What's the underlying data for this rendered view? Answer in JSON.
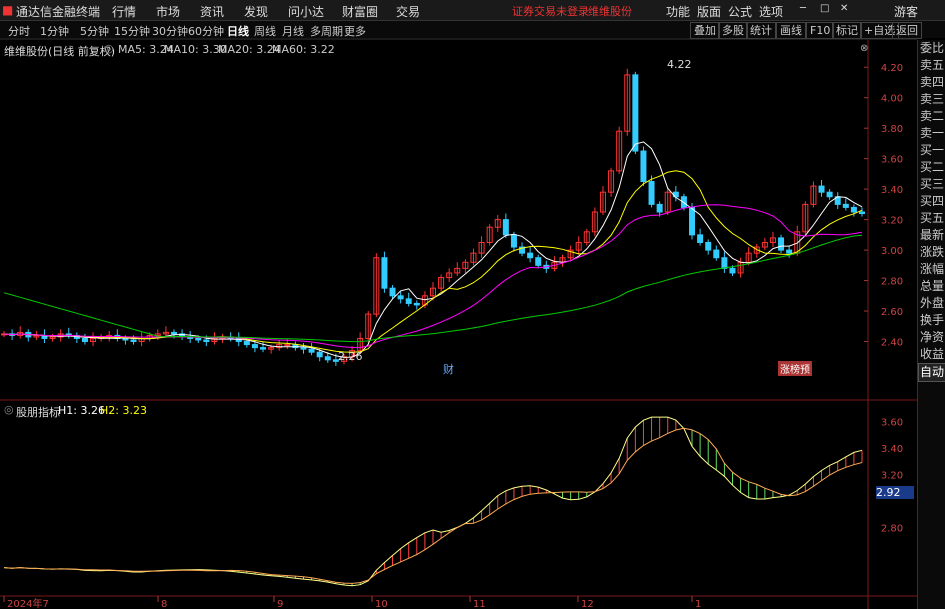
{
  "topbar": {
    "title": "通达信金融终端",
    "menus": [
      "行情",
      "市场",
      "资讯",
      "发现",
      "问小达",
      "财富圈",
      "交易"
    ],
    "notice": "证券交易未登录",
    "stock_name": "维维股份",
    "right_menus": [
      "功能",
      "版面",
      "公式",
      "选项"
    ],
    "user": "游客"
  },
  "periods": [
    "分时",
    "1分钟",
    "5分钟",
    "15分钟",
    "30分钟",
    "60分钟",
    "日线",
    "周线",
    "月线",
    "多周期",
    "更多"
  ],
  "active_period": "日线",
  "toolbar_buttons": [
    "叠加",
    "多股",
    "统计",
    "画线",
    "F10",
    "标记",
    "+自选",
    "返回"
  ],
  "main_chart": {
    "header": "维维股份(日线 前复权)",
    "ma": [
      {
        "label": "MA5: 3.24",
        "color": "#ffffff"
      },
      {
        "label": "MA10: 3.30",
        "color": "#ffff00"
      },
      {
        "label": "MA20: 3.24",
        "color": "#ff00ff"
      },
      {
        "label": "MA60: 3.22",
        "color": "#00ff00"
      }
    ],
    "price_labels": [
      "4.20",
      "4.00",
      "3.80",
      "3.60",
      "3.40",
      "3.20",
      "3.00",
      "2.80",
      "2.60",
      "2.40"
    ],
    "high_label": "4.22",
    "low_label": "2.26",
    "marker_cai": "财",
    "marker_zt": "涨榜预"
  },
  "sub_chart": {
    "header": "股朋指标",
    "h1": "H1: 3.26",
    "h2": "H2: 3.23",
    "labels": [
      "3.60",
      "3.40",
      "3.20",
      "2.80"
    ],
    "current": "2.92"
  },
  "x_axis": {
    "labels": [
      "2024年7",
      "8",
      "9",
      "10",
      "11",
      "12",
      "1"
    ]
  },
  "sidebar": [
    "委比",
    "卖五",
    "卖四",
    "卖三",
    "卖二",
    "卖一",
    "买一",
    "买二",
    "买三",
    "买四",
    "买五",
    "最新",
    "涨跌",
    "涨幅",
    "总量",
    "外盘",
    "换手",
    "净资",
    "收益",
    "自动"
  ],
  "chart_data": {
    "type": "line",
    "ylim": [
      2.2,
      4.3
    ],
    "close": [
      2.45,
      2.44,
      2.46,
      2.43,
      2.44,
      2.42,
      2.43,
      2.45,
      2.44,
      2.42,
      2.4,
      2.42,
      2.43,
      2.44,
      2.42,
      2.41,
      2.4,
      2.42,
      2.44,
      2.45,
      2.46,
      2.45,
      2.43,
      2.42,
      2.41,
      2.4,
      2.42,
      2.43,
      2.42,
      2.4,
      2.38,
      2.36,
      2.35,
      2.36,
      2.38,
      2.38,
      2.36,
      2.35,
      2.33,
      2.3,
      2.28,
      2.27,
      2.3,
      2.34,
      2.42,
      2.58,
      2.95,
      2.75,
      2.7,
      2.68,
      2.65,
      2.64,
      2.7,
      2.75,
      2.82,
      2.85,
      2.88,
      2.92,
      2.98,
      3.05,
      3.15,
      3.2,
      3.1,
      3.02,
      2.98,
      2.95,
      2.9,
      2.88,
      2.92,
      2.95,
      3.0,
      3.05,
      3.12,
      3.25,
      3.38,
      3.52,
      3.78,
      4.15,
      3.65,
      3.45,
      3.3,
      3.25,
      3.38,
      3.35,
      3.28,
      3.1,
      3.05,
      3.0,
      2.95,
      2.88,
      2.85,
      2.92,
      2.98,
      3.02,
      3.05,
      3.08,
      3.0,
      2.98,
      3.12,
      3.3,
      3.42,
      3.38,
      3.35,
      3.3,
      3.28,
      3.25,
      3.24
    ]
  }
}
